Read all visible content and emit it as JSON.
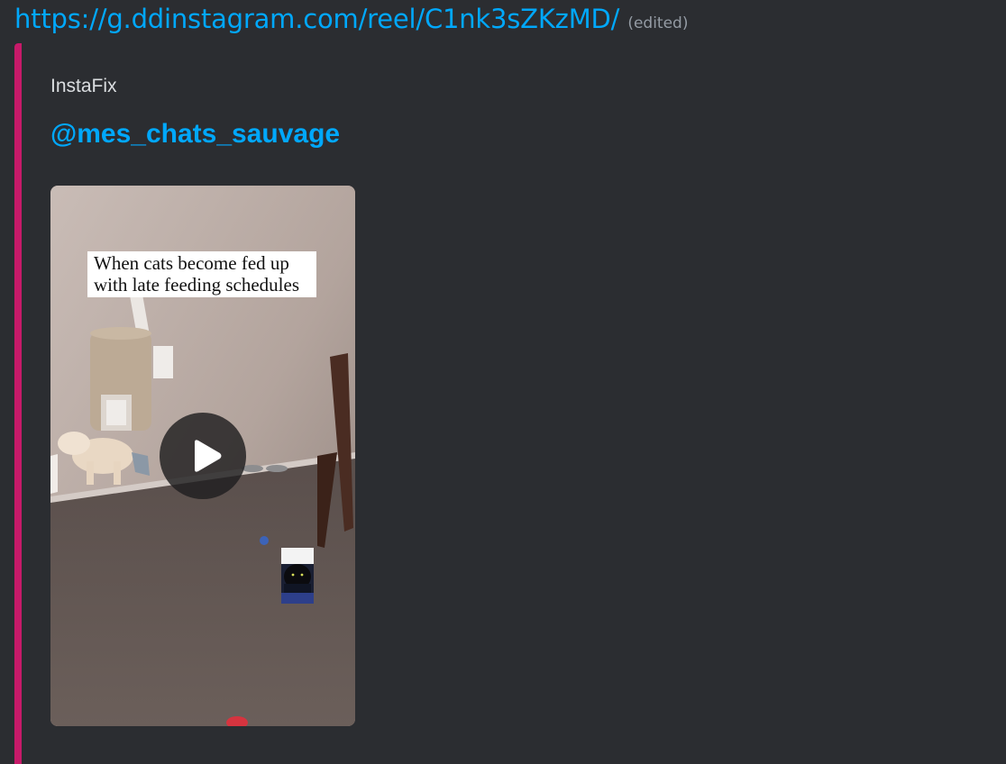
{
  "message": {
    "link_text": "https://g.ddinstagram.com/reel/C1nk3sZKzMD/",
    "edited_label": "(edited)"
  },
  "embed": {
    "accent_color": "#c71a69",
    "provider": "InstaFix",
    "author": "@mes_chats_sauvage",
    "video": {
      "caption_lines": [
        "When cats become fed up",
        "with late feeding schedules"
      ],
      "play_icon": "play-icon"
    }
  },
  "colors": {
    "background": "#2b2d31",
    "link": "#00a8fc",
    "muted": "#949ba4",
    "text": "#dbdee1"
  }
}
